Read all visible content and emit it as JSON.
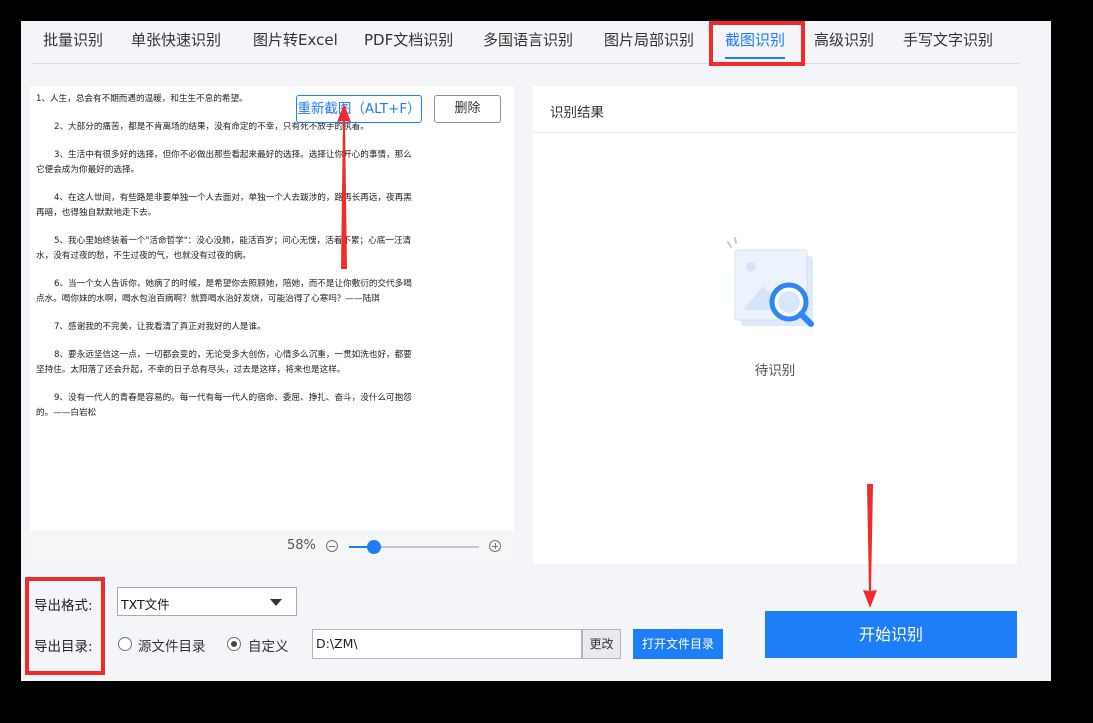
{
  "tabs": [
    {
      "label": "批量识别",
      "active": false
    },
    {
      "label": "单张快速识别",
      "active": false
    },
    {
      "label": "图片转Excel",
      "active": false
    },
    {
      "label": "PDF文档识别",
      "active": false
    },
    {
      "label": "多国语言识别",
      "active": false
    },
    {
      "label": "图片局部识别",
      "active": false
    },
    {
      "label": "截图识别",
      "active": true
    },
    {
      "label": "高级识别",
      "active": false
    },
    {
      "label": "手写文字识别",
      "active": false
    }
  ],
  "preview": {
    "recapture_label": "重新截图（ALT+F）",
    "delete_label": "删除",
    "zoom_percent": "58%",
    "zoom_level": 0.58,
    "paragraphs": [
      "1、人生，总会有不期而遇的温暖，和生生不息的希望。",
      "2、大部分的痛苦，都是不肯离场的结果，没有命定的不幸，只有死不放手的执着。",
      "3、生活中有很多好的选择，但你不必做出那些看起来最好的选择。选择让你开心的事情，那么它便会成为你最好的选择。",
      "4、在这人世间，有些路是非要单独一个人去面对，单独一个人去跋涉的，路再长再远，夜再黑再暗，也得独自默默地走下去。",
      "5、我心里始终装着一个\"活命哲学\"：没心没肺，能活百岁；问心无愧，活着不累；心底一汪清水，没有过夜的愁，不生过夜的气，也就没有过夜的病。",
      "6、当一个女人告诉你，她病了的时候，是希望你去照顾她，陪她，而不是让你敷衍的交代多喝点水。喝你妹的水啊，喝水包治百病啊？就算喝水治好发烧，可能治得了心寒吗？——陆琪",
      "7、感谢我的不完美，让我看清了真正对我好的人是谁。",
      "8、要永远坚信这一点，一切都会变的，无论受多大创伤，心情多么沉重，一贯如洗也好，都要坚持住。太阳落了还会升起，不幸的日子总有尽头，过去是这样，将来也是这样。",
      "9、没有一代人的青春是容易的。每一代有每一代人的宿命、委屈、挣扎、奋斗，没什么可抱怨的。——白岩松"
    ]
  },
  "result": {
    "title": "识别结果",
    "empty_text": "待识别"
  },
  "settings": {
    "format_label": "导出格式:",
    "format_value": "TXT文件",
    "dir_label": "导出目录:",
    "radio_source": "源文件目录",
    "radio_custom": "自定义",
    "selected_dir_option": "custom",
    "path_value": "D:\\ZM\\",
    "change_label": "更改",
    "open_dir_label": "打开文件目录"
  },
  "start_label": "开始识别",
  "colors": {
    "accent": "#1e7ef7",
    "annotation": "#ef2b2b"
  }
}
